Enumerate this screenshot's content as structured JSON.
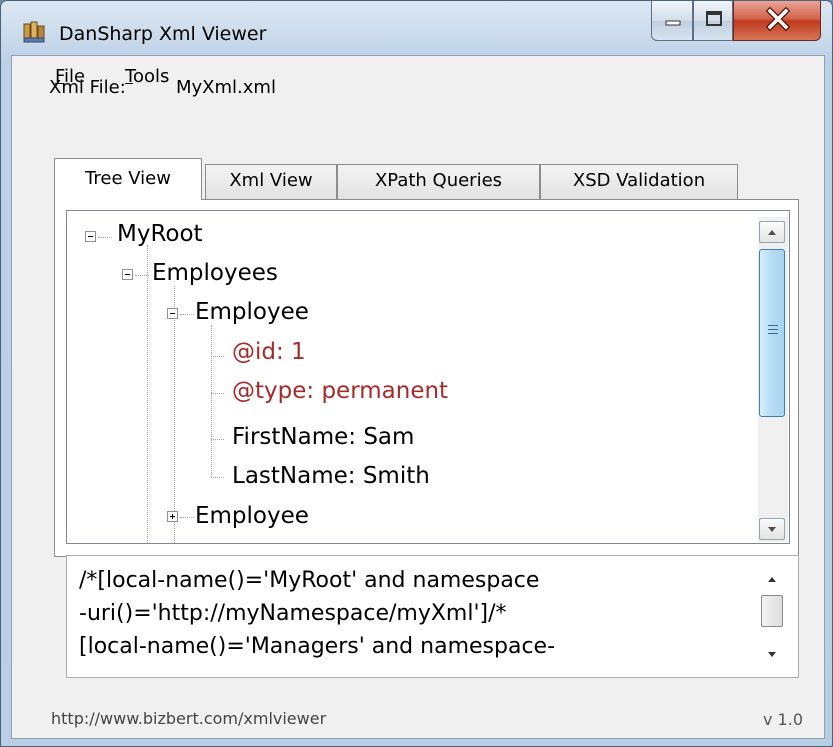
{
  "window": {
    "title": "DanSharp Xml Viewer",
    "app_icon": "xml-viewer-app-icon",
    "controls": {
      "minimize": "minimize-icon",
      "maximize": "maximize-icon",
      "close": "close-icon"
    }
  },
  "menu": {
    "file": {
      "mnemonic": "F",
      "rest": "ile"
    },
    "tools": {
      "mnemonic": "T",
      "rest": "ools"
    }
  },
  "xml_file": {
    "label": "Xml File:",
    "value": "MyXml.xml"
  },
  "tabs": [
    {
      "label": "Tree View",
      "active": true
    },
    {
      "label": "Xml View",
      "active": false
    },
    {
      "label": "XPath Queries",
      "active": false
    },
    {
      "label": "XSD Validation",
      "active": false
    }
  ],
  "tree": {
    "nodes": [
      {
        "text": "MyRoot",
        "expander": "minus",
        "kind": "element"
      },
      {
        "text": "Employees",
        "expander": "minus",
        "kind": "element"
      },
      {
        "text": "Employee",
        "expander": "minus",
        "kind": "element"
      },
      {
        "text": "@id: 1",
        "expander": "none",
        "kind": "attribute"
      },
      {
        "text": "@type: permanent",
        "expander": "none",
        "kind": "attribute"
      },
      {
        "text": "FirstName: Sam",
        "expander": "none",
        "kind": "element"
      },
      {
        "text": "LastName: Smith",
        "expander": "none",
        "kind": "element"
      },
      {
        "text": "Employee",
        "expander": "plus",
        "kind": "element"
      }
    ],
    "attribute_color": "#a52a2a"
  },
  "xpath": {
    "lines": [
      "/*[local-name()='MyRoot' and namespace",
      "-uri()='http://myNamespace/myXml']/*",
      "[local-name()='Managers' and namespace-"
    ]
  },
  "status": {
    "url": "http://www.bizbert.com/xmlviewer",
    "version": "v 1.0"
  }
}
